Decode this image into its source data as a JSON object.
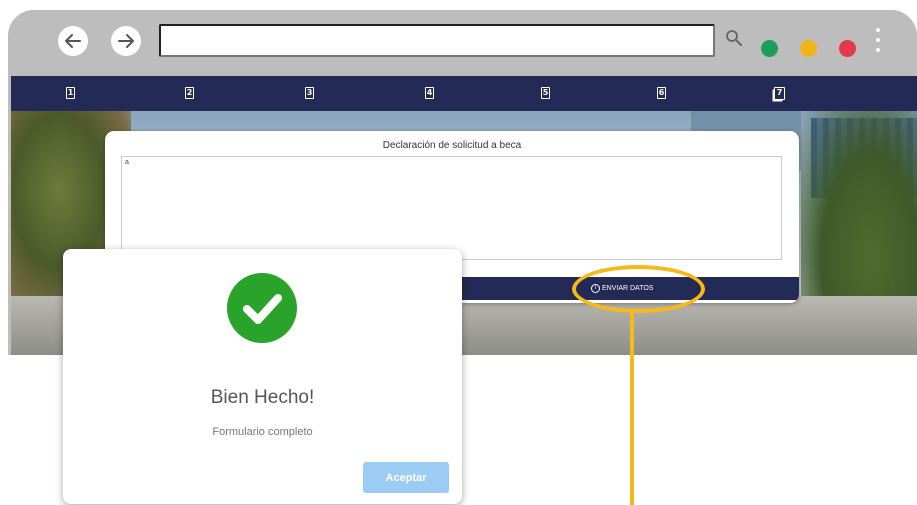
{
  "browser": {
    "back_icon": "arrow-left-icon",
    "forward_icon": "arrow-right-icon",
    "address_value": "",
    "window_dots": [
      "#1d9f5a",
      "#f0b31a",
      "#e5394a"
    ]
  },
  "topnav": {
    "steps": [
      "1",
      "2",
      "3",
      "4",
      "5",
      "6",
      "7"
    ]
  },
  "form": {
    "title": "Declaración de solicitud a beca",
    "textarea_value": "a",
    "send_label": "ENVIAR DATOS"
  },
  "modal": {
    "title": "Bien Hecho!",
    "message": "Formulario completo",
    "accept_label": "Aceptar"
  },
  "colors": {
    "nav_bar": "#232a55",
    "success": "#2aa32a",
    "highlight": "#f7b81a",
    "accept_button": "#9ccbf3"
  }
}
